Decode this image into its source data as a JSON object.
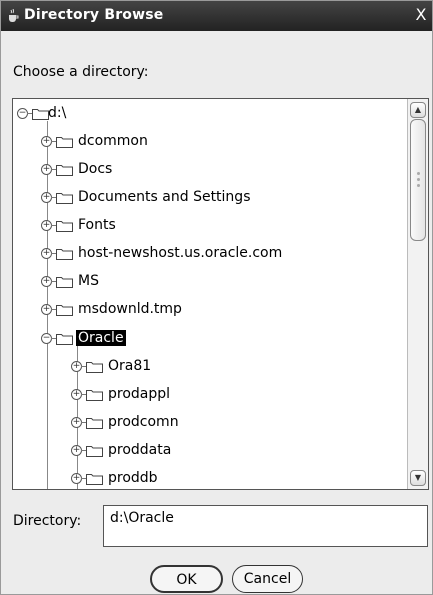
{
  "window": {
    "title": "Directory Browse",
    "close_glyph": "X",
    "title_icon": "java-cup-icon"
  },
  "prompt": "Choose a directory:",
  "tree": {
    "root": {
      "label": "d:\\",
      "expanded": true
    },
    "children": [
      {
        "label": "dcommon",
        "expanded": false
      },
      {
        "label": "Docs",
        "expanded": false
      },
      {
        "label": "Documents and Settings",
        "expanded": false
      },
      {
        "label": "Fonts",
        "expanded": false
      },
      {
        "label": "host-newshost.us.oracle.com",
        "expanded": false
      },
      {
        "label": "MS",
        "expanded": false
      },
      {
        "label": "msdownld.tmp",
        "expanded": false
      },
      {
        "label": "Oracle",
        "expanded": true,
        "selected": true
      }
    ],
    "oracle_children": [
      {
        "label": "Ora81",
        "expanded": false
      },
      {
        "label": "prodappl",
        "expanded": false
      },
      {
        "label": "prodcomn",
        "expanded": false
      },
      {
        "label": "proddata",
        "expanded": false
      },
      {
        "label": "proddb",
        "expanded": false
      }
    ]
  },
  "directory": {
    "label": "Directory:",
    "value": "d:\\Oracle"
  },
  "buttons": {
    "ok": "OK",
    "cancel": "Cancel"
  },
  "colors": {
    "titlebar": "#2b2b2b",
    "selection": "#000000",
    "background": "#ececec"
  }
}
